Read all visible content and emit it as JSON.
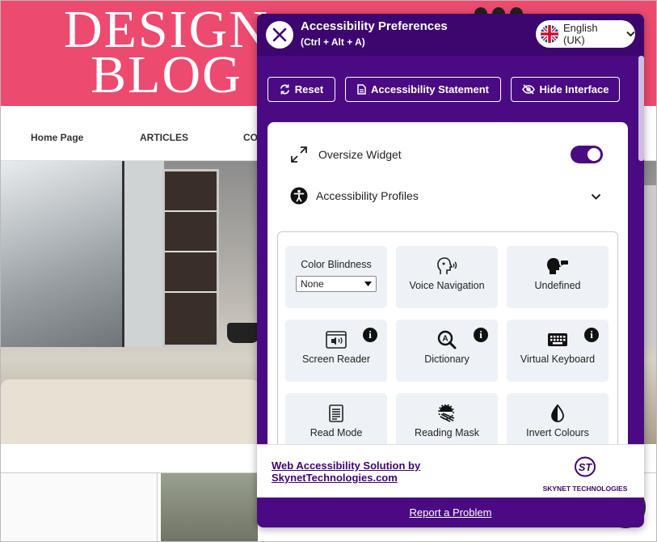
{
  "site": {
    "logo_line1": "DESIGN",
    "logo_line2": "BLOG",
    "nav": [
      "Home Page",
      "ARTICLES",
      "CON"
    ]
  },
  "widget": {
    "title": "Accessibility Preferences",
    "shortcut": "(Ctrl + Alt + A)",
    "language": "English (UK)",
    "toolbar": {
      "reset": "Reset",
      "statement": "Accessibility Statement",
      "hide": "Hide Interface"
    },
    "oversize_label": "Oversize Widget",
    "oversize_on": true,
    "profiles_label": "Accessibility Profiles",
    "tiles": {
      "color_blindness": "Color Blindness",
      "color_blindness_value": "None",
      "voice_navigation": "Voice Navigation",
      "undefined": "Undefined",
      "screen_reader": "Screen Reader",
      "dictionary": "Dictionary",
      "virtual_keyboard": "Virtual Keyboard",
      "read_mode": "Read Mode",
      "reading_mask": "Reading Mask",
      "invert_colours": "Invert Colours"
    },
    "footer": {
      "link_line1": "Web Accessibility Solution by",
      "link_line2": "SkynetTechnologies.com",
      "brand_mark": "ST",
      "brand_name": "SKYNET TECHNOLOGIES"
    },
    "report": "Report a Problem"
  },
  "colors": {
    "primary": "#4a0b82",
    "header": "#3c066e",
    "site_header": "#ec4a6f",
    "tile_bg": "#eef2f6"
  },
  "icons": [
    "close-icon",
    "uk-flag-icon",
    "chevron-down-icon",
    "reset-icon",
    "document-icon",
    "eye-slash-icon",
    "expand-icon",
    "accessibility-icon",
    "voice-icon",
    "speaking-head-icon",
    "screen-reader-icon",
    "dictionary-icon",
    "keyboard-icon",
    "info-icon",
    "read-mode-icon",
    "reading-mask-icon",
    "invert-icon"
  ]
}
